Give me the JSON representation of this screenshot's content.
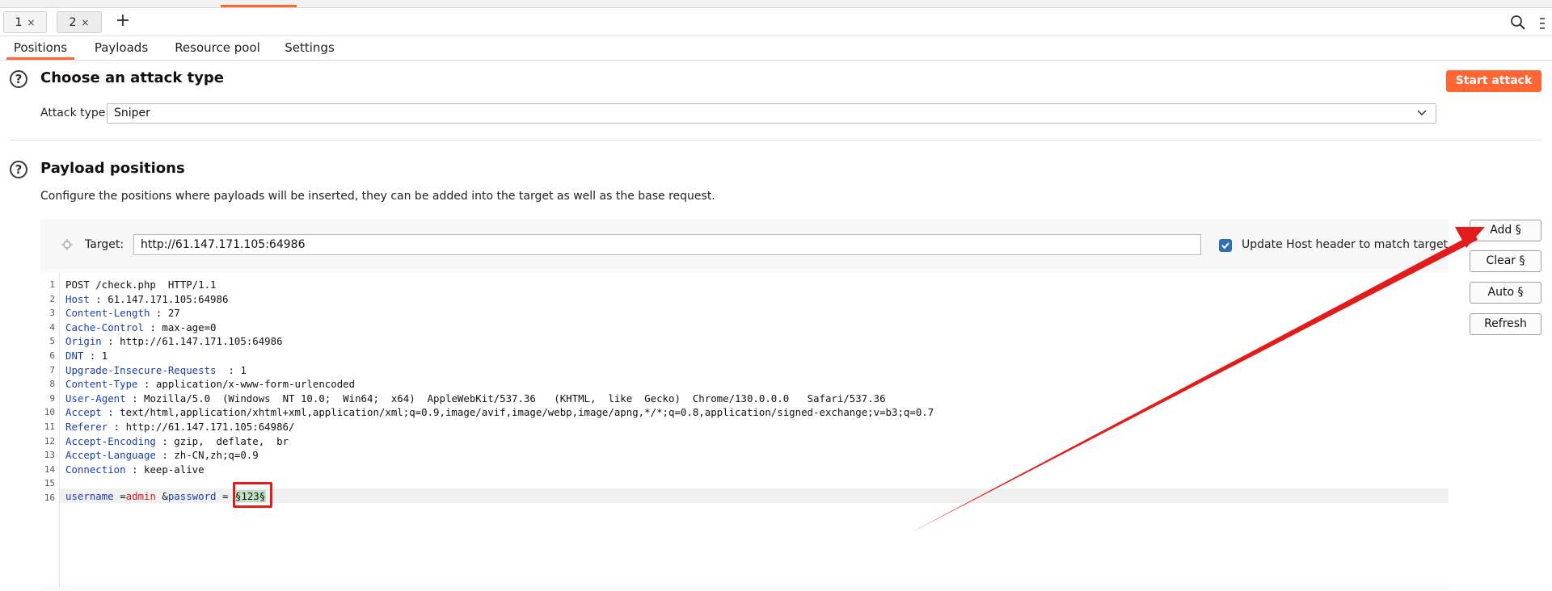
{
  "tabs": [
    {
      "label": "1",
      "close": "×"
    },
    {
      "label": "2",
      "close": "×"
    }
  ],
  "new_tab": "+",
  "subtabs": [
    "Positions",
    "Payloads",
    "Resource pool",
    "Settings"
  ],
  "attack_section": {
    "help": "?",
    "title": "Choose an attack type",
    "start_button": "Start attack",
    "attack_type_label": "Attack type:",
    "attack_type_value": "Sniper"
  },
  "positions_section": {
    "help": "?",
    "title": "Payload positions",
    "description": "Configure the positions where payloads will be inserted, they can be added into the target as well as the base request.",
    "target_label": "Target:",
    "target_value": "http://61.147.171.105:64986",
    "update_host_label": "Update Host header to match target",
    "update_host_checked": true,
    "buttons": {
      "add": "Add §",
      "clear": "Clear §",
      "auto": "Auto §",
      "refresh": "Refresh"
    }
  },
  "request": {
    "line_numbers": [
      "1",
      "2",
      "3",
      "4",
      "5",
      "6",
      "7",
      "8",
      "9",
      "10",
      "11",
      "12",
      "13",
      "14",
      "15",
      "16"
    ],
    "request_line": "POST /check.php  HTTP/1.1",
    "headers": [
      {
        "name": "Host",
        "value": " : 61.147.171.105:64986"
      },
      {
        "name": "Content-Length",
        "value": " : 27"
      },
      {
        "name": "Cache-Control",
        "value": " : max-age=0"
      },
      {
        "name": "Origin",
        "value": " : http://61.147.171.105:64986"
      },
      {
        "name": "DNT",
        "value": " : 1"
      },
      {
        "name": "Upgrade-Insecure-Requests",
        "value": "  : 1"
      },
      {
        "name": "Content-Type",
        "value": " : application/x-www-form-urlencoded"
      },
      {
        "name": "User-Agent",
        "value": " : Mozilla/5.0  (Windows  NT 10.0;  Win64;  x64)  AppleWebKit/537.36   (KHTML,  like  Gecko)  Chrome/130.0.0.0   Safari/537.36"
      },
      {
        "name": "Accept",
        "value": " : text/html,application/xhtml+xml,application/xml;q=0.9,image/avif,image/webp,image/apng,*/*;q=0.8,application/signed-exchange;v=b3;q=0.7"
      },
      {
        "name": "Referer",
        "value": " : http://61.147.171.105:64986/"
      },
      {
        "name": "Accept-Encoding",
        "value": " : gzip,  deflate,  br"
      },
      {
        "name": "Accept-Language",
        "value": " : zh-CN,zh;q=0.9"
      },
      {
        "name": "Connection",
        "value": " : keep-alive"
      }
    ],
    "body": {
      "param1_name": "username",
      "eq1": " =",
      "param1_value": "admin",
      "amp": " &",
      "param2_name": "password",
      "eq2": " = ",
      "payload": "§123§"
    }
  },
  "annotation_color": "#e21b1b",
  "accent_color": "#ff6633"
}
